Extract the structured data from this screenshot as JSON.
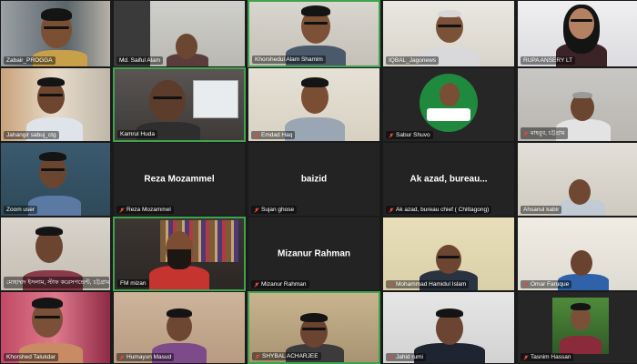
{
  "meeting": {
    "participants": [
      {
        "name": "Zabair_PROGGA",
        "muted": false
      },
      {
        "name": "Md. Saiful Alam",
        "muted": false
      },
      {
        "name": "Khorshedul Alam Shamim",
        "muted": false
      },
      {
        "name": "IQBAL_Jagonews",
        "muted": false
      },
      {
        "name": "RUPA ANSERY LT",
        "muted": false
      },
      {
        "name": "Jahangir sabuj_ctg",
        "muted": false
      },
      {
        "name": "Kamrul Huda",
        "muted": false
      },
      {
        "name": "Emdad Haq",
        "muted": true
      },
      {
        "name": "Sabur Shuvo",
        "muted": true
      },
      {
        "name": "মাহবুব, চট্টগ্রাম",
        "muted": true
      },
      {
        "name": "Zoom user",
        "muted": false
      },
      {
        "name": "Reza Mozammel",
        "muted": true,
        "display": "Reza Mozammel"
      },
      {
        "name": "Sujan ghose",
        "muted": true,
        "display": "baizid"
      },
      {
        "name": "Ak azad, bureau chief ( Chittagong)",
        "muted": true,
        "display": "Ak azad, bureau..."
      },
      {
        "name": "Ahsanul kabir",
        "muted": false
      },
      {
        "name": "মোহাম্মদ ইসলাম, স্টাফ করেসপন্ডেন্ট, চট্টগ্রাম অফ...",
        "muted": false
      },
      {
        "name": "FM mizan",
        "muted": false
      },
      {
        "name": "Mizanur Rahman",
        "muted": true,
        "display": "Mizanur Rahman"
      },
      {
        "name": "Mohammad Hamidul Islam",
        "muted": true
      },
      {
        "name": "Omar Faruque",
        "muted": true
      },
      {
        "name": "Khorshed Talukdar",
        "muted": false
      },
      {
        "name": "Humayun Masud",
        "muted": true
      },
      {
        "name": "SHYBAL ACHARJEE",
        "muted": true
      },
      {
        "name": "Jahid rumi",
        "muted": true
      },
      {
        "name": "Tasnim Hassan",
        "muted": true
      }
    ]
  },
  "colors": {
    "active_border": "#3fa34d",
    "mute_icon": "#e04a3b",
    "tile_background": "#262626"
  }
}
